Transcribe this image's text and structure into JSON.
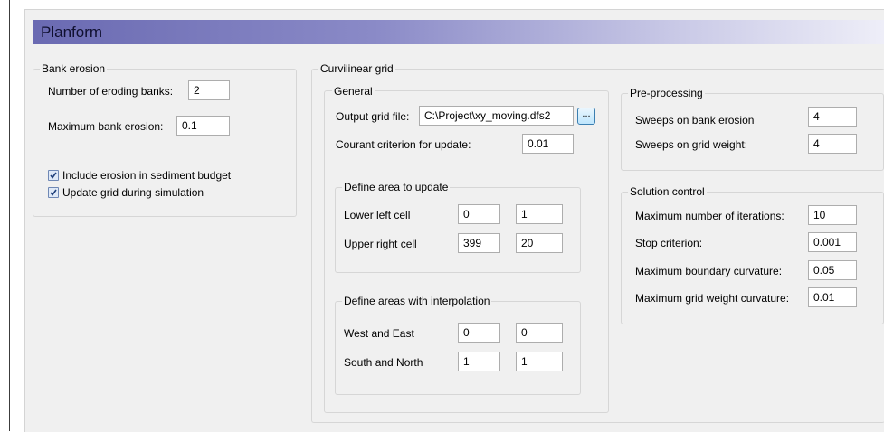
{
  "header": {
    "title": "Planform"
  },
  "bank_erosion": {
    "legend": "Bank erosion",
    "num_banks_label": "Number of eroding banks:",
    "num_banks_value": "2",
    "max_erosion_label": "Maximum bank erosion:",
    "max_erosion_value": "0.1",
    "include_erosion_label": "Include erosion in sediment budget",
    "include_erosion_checked": true,
    "update_grid_label": "Update grid during simulation",
    "update_grid_checked": true
  },
  "curvilinear_grid": {
    "legend": "Curvilinear grid",
    "general": {
      "legend": "General",
      "output_file_label": "Output grid file:",
      "output_file_value": "C:\\Project\\xy_moving.dfs2",
      "browse_label": "...",
      "courant_label": "Courant criterion for update:",
      "courant_value": "0.01"
    },
    "define_area": {
      "legend": "Define area to update",
      "lower_left_label": "Lower left cell",
      "lower_left_1": "0",
      "lower_left_2": "1",
      "upper_right_label": "Upper right cell",
      "upper_right_1": "399",
      "upper_right_2": "20"
    },
    "interpolation": {
      "legend": "Define areas with interpolation",
      "west_east_label": "West and East",
      "west_east_1": "0",
      "west_east_2": "0",
      "south_north_label": "South and North",
      "south_north_1": "1",
      "south_north_2": "1"
    },
    "preprocessing": {
      "legend": "Pre-processing",
      "sweeps_bank_label": "Sweeps on bank erosion",
      "sweeps_bank_value": "4",
      "sweeps_grid_label": "Sweeps on grid weight:",
      "sweeps_grid_value": "4"
    },
    "solution_control": {
      "legend": "Solution control",
      "max_iter_label": "Maximum number of iterations:",
      "max_iter_value": "10",
      "stop_label": "Stop criterion:",
      "stop_value": "0.001",
      "max_boundary_label": "Maximum boundary curvature:",
      "max_boundary_value": "0.05",
      "max_weight_label": "Maximum grid weight curvature:",
      "max_weight_value": "0.01"
    }
  }
}
